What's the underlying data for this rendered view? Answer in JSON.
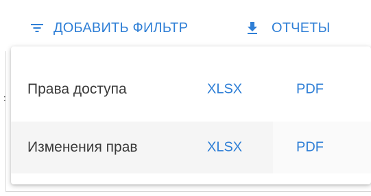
{
  "toolbar": {
    "add_filter_label": "ДОБАВИТЬ ФИЛЬТР",
    "reports_label": "ОТЧЕТЫ",
    "filter_icon": "filter-list-icon",
    "download_icon": "download-icon"
  },
  "reports_menu": {
    "items": [
      {
        "label": "Права доступа",
        "xlsx": "XLSX",
        "pdf": "PDF"
      },
      {
        "label": "Изменения прав",
        "xlsx": "XLSX",
        "pdf": "PDF"
      }
    ]
  },
  "colors": {
    "accent": "#2f7fd6",
    "text": "#3a3a3a",
    "hover_row": "#f5f5f5"
  }
}
